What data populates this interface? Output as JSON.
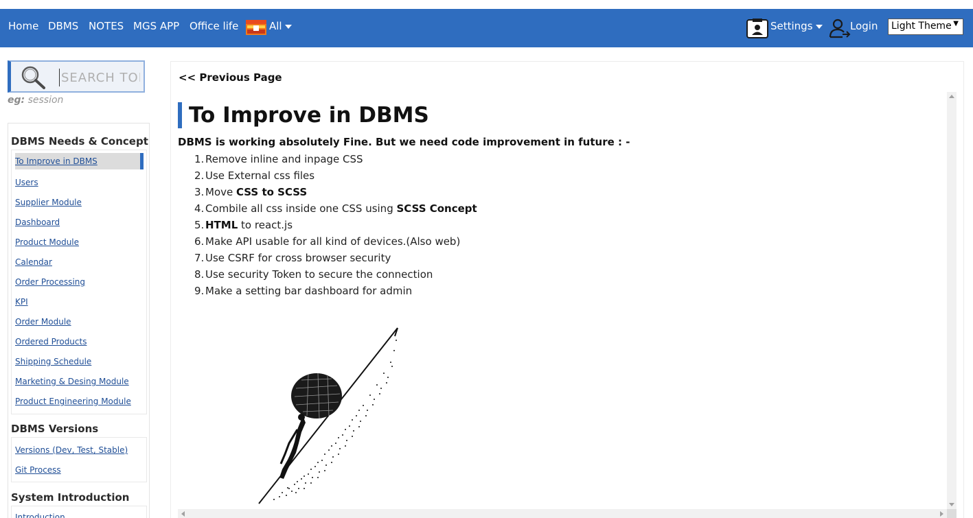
{
  "navbar": {
    "items": [
      "Home",
      "DBMS",
      "NOTES",
      "MGS APP",
      "Office life"
    ],
    "all_label": "All",
    "settings_label": "Settings",
    "login_label": "Login",
    "theme_value": "Light Theme",
    "bg_color": "#2f6dbf"
  },
  "search": {
    "placeholder": "SEARCH TOPIC",
    "hint_prefix": "eg:",
    "hint_value": "session"
  },
  "sidebar": {
    "sections": [
      {
        "title": "DBMS Needs & Concept",
        "links": [
          "To Improve in DBMS",
          "Users",
          "Supplier Module",
          "Dashboard",
          "Product Module",
          "Calendar",
          "Order Processing",
          "KPI",
          "Order Module",
          "Ordered Products",
          "Shipping Schedule",
          "Marketing & Desing Module",
          "Product Engineering Module"
        ]
      },
      {
        "title": "DBMS Versions",
        "links": [
          "Versions (Dev, Test, Stable)",
          "Git Process"
        ]
      },
      {
        "title": "System Introduction",
        "links": [
          "Introduction"
        ]
      }
    ],
    "active_link": "To Improve in DBMS"
  },
  "content": {
    "prev_link": "<< Previous Page",
    "title": "To Improve in DBMS",
    "intro": "DBMS is working absolutely Fine. But we need code improvement in future : -",
    "items": [
      {
        "pre": "Remove inline and inpage CSS",
        "bold": "",
        "post": ""
      },
      {
        "pre": "Use External css files",
        "bold": "",
        "post": ""
      },
      {
        "pre": "Move ",
        "bold": "CSS to SCSS",
        "post": ""
      },
      {
        "pre": "Combile all css inside one CSS using ",
        "bold": "SCSS Concept",
        "post": ""
      },
      {
        "pre": "",
        "bold": "HTML",
        "post": " to react.js"
      },
      {
        "pre": "Make API usable for all kind of devices.(Also web)",
        "bold": "",
        "post": ""
      },
      {
        "pre": "Use CSRF for cross browser security",
        "bold": "",
        "post": ""
      },
      {
        "pre": "Use security Token to secure the connection",
        "bold": "",
        "post": ""
      },
      {
        "pre": "Make a setting bar dashboard for admin",
        "bold": "",
        "post": ""
      }
    ],
    "illustration_icon": "sisyphus-boulder-illustration"
  }
}
